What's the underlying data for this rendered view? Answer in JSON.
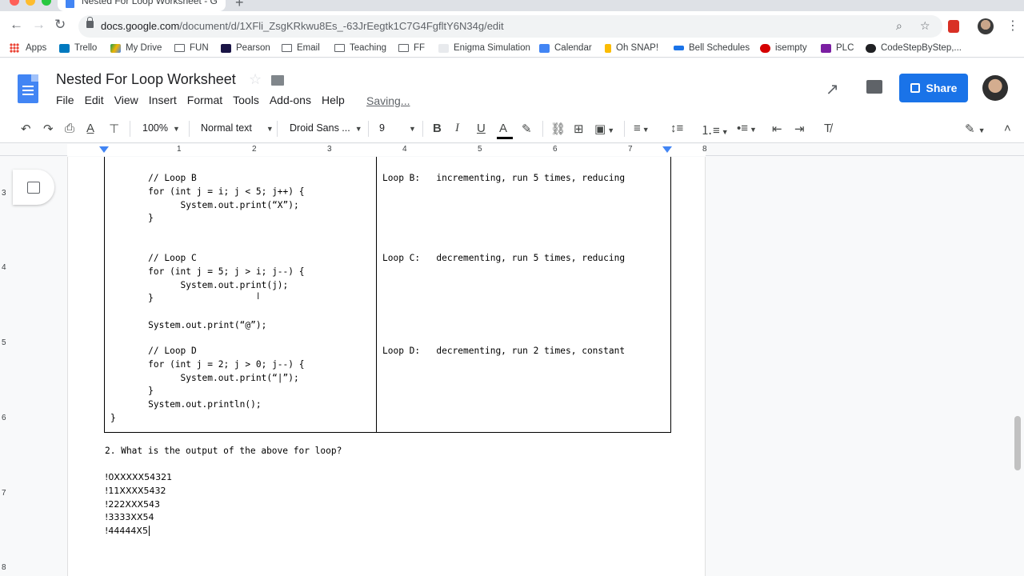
{
  "browser": {
    "tab_title": "Nested For Loop Worksheet - G",
    "url_host": "docs.google.com",
    "url_path": "/document/d/1XFli_ZsgKRkwu8Es_-63JrEegtk1C7G4FgfltY6N34g/edit",
    "colors": {
      "close": "#ff5f57",
      "minimize": "#febc2e",
      "maximize": "#28c840"
    }
  },
  "bookmarks": [
    {
      "label": "Apps"
    },
    {
      "label": "Trello"
    },
    {
      "label": "My Drive"
    },
    {
      "label": "FUN"
    },
    {
      "label": "Pearson"
    },
    {
      "label": "Email"
    },
    {
      "label": "Teaching"
    },
    {
      "label": "FF"
    },
    {
      "label": "Enigma Simulation"
    },
    {
      "label": "Calendar"
    },
    {
      "label": "Oh SNAP!"
    },
    {
      "label": "Bell Schedules"
    },
    {
      "label": "isempty"
    },
    {
      "label": "PLC"
    },
    {
      "label": "CodeStepByStep,..."
    }
  ],
  "docs": {
    "title": "Nested For Loop Worksheet",
    "menu": [
      "File",
      "Edit",
      "View",
      "Insert",
      "Format",
      "Tools",
      "Add-ons",
      "Help"
    ],
    "status": "Saving...",
    "share_label": "Share",
    "accent": "#1a73e8"
  },
  "toolbar": {
    "zoom": "100%",
    "style": "Normal text",
    "font": "Droid Sans ...",
    "size": "9"
  },
  "ruler": {
    "numbers": [
      "1",
      "2",
      "3",
      "4",
      "5",
      "6",
      "7",
      "8"
    ],
    "vnumbers": [
      "3",
      "4",
      "5",
      "6",
      "7",
      "8"
    ]
  },
  "document": {
    "code_lines": [
      "       // Loop B",
      "       for (int j = i; j < 5; j++) {",
      "             System.out.print(“X”);",
      "       }",
      "",
      "",
      "       // Loop C",
      "       for (int j = 5; j > i; j--) {",
      "             System.out.print(j);",
      "       }",
      "",
      "       System.out.print(“@”);",
      "",
      "       // Loop D",
      "       for (int j = 2; j > 0; j--) {",
      "             System.out.print(“|”);",
      "       }",
      "       System.out.println();",
      "}"
    ],
    "annotations": [
      "Loop B:   incrementing, run 5 times, reducing",
      "Loop C:   decrementing, run 5 times, reducing",
      "Loop D:   decrementing, run 2 times, constant"
    ],
    "question": "2. What is the output of the above for loop?",
    "output_lines": [
      "!0XXXXX54321",
      "!11XXXX5432",
      "!222XXX543",
      "!3333XX54",
      "!44444X5"
    ]
  }
}
